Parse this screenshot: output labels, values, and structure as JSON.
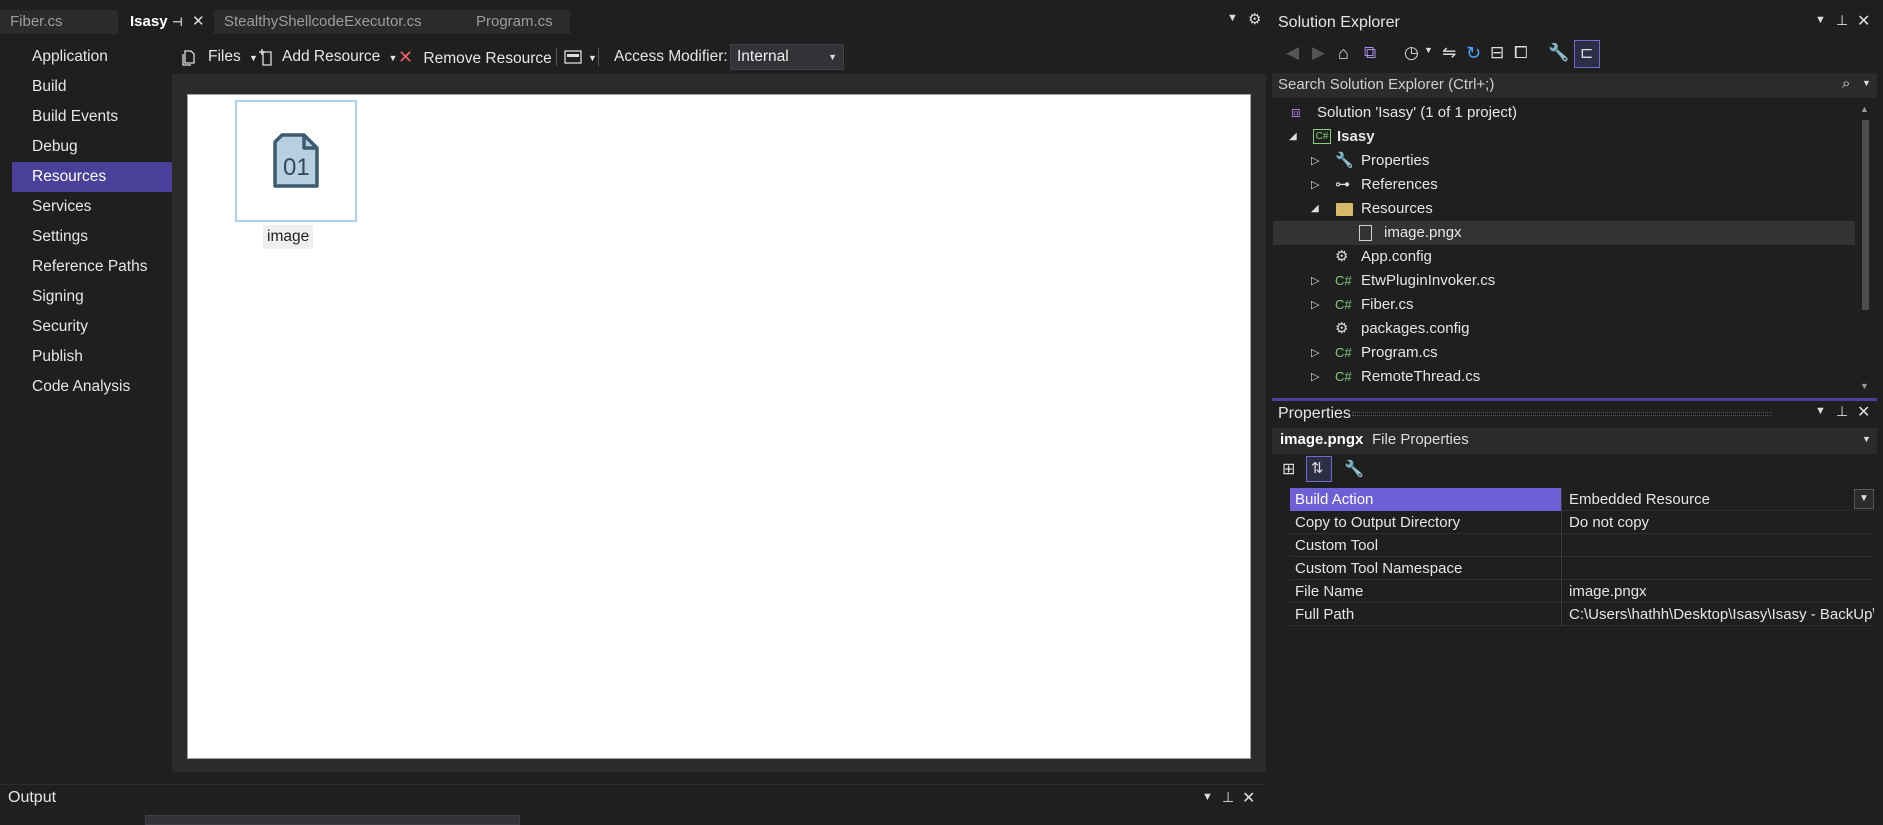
{
  "tabs": [
    {
      "label": "Fiber.cs"
    },
    {
      "label": "Isasy"
    },
    {
      "label": "StealthyShellcodeExecutor.cs"
    },
    {
      "label": "Program.cs"
    }
  ],
  "nav": {
    "items": [
      "Application",
      "Build",
      "Build Events",
      "Debug",
      "Resources",
      "Services",
      "Settings",
      "Reference Paths",
      "Signing",
      "Security",
      "Publish",
      "Code Analysis"
    ],
    "selected": "Resources"
  },
  "toolbar": {
    "files_label": "Files",
    "add_resource_label": "Add Resource",
    "remove_resource_label": "Remove Resource",
    "access_modifier_label": "Access Modifier:",
    "access_modifier_value": "Internal"
  },
  "resource": {
    "label": "image",
    "icon_text": "01"
  },
  "solution_explorer": {
    "title": "Solution Explorer",
    "search_placeholder": "Search Solution Explorer (Ctrl+;)",
    "solution_label": "Solution 'Isasy' (1 of 1 project)",
    "tree": [
      {
        "label": "Isasy",
        "icon": "csharp-project-icon"
      },
      {
        "label": "Properties",
        "icon": "wrench-icon"
      },
      {
        "label": "References",
        "icon": "references-icon"
      },
      {
        "label": "Resources",
        "icon": "folder-icon"
      },
      {
        "label": "image.pngx",
        "icon": "file-icon"
      },
      {
        "label": "App.config",
        "icon": "config-icon"
      },
      {
        "label": "EtwPluginInvoker.cs",
        "icon": "csharp-file-icon"
      },
      {
        "label": "Fiber.cs",
        "icon": "csharp-file-icon"
      },
      {
        "label": "packages.config",
        "icon": "config-icon"
      },
      {
        "label": "Program.cs",
        "icon": "csharp-file-icon"
      },
      {
        "label": "RemoteThread.cs",
        "icon": "csharp-file-icon"
      }
    ]
  },
  "properties": {
    "title": "Properties",
    "object_name": "image.pngx",
    "object_type": "File Properties",
    "rows": [
      {
        "name": "Build Action",
        "value": "Embedded Resource"
      },
      {
        "name": "Copy to Output Directory",
        "value": "Do not copy"
      },
      {
        "name": "Custom Tool",
        "value": ""
      },
      {
        "name": "Custom Tool Namespace",
        "value": ""
      },
      {
        "name": "File Name",
        "value": "image.pngx"
      },
      {
        "name": "Full Path",
        "value": "C:\\Users\\hathh\\Desktop\\Isasy\\Isasy - BackUp\\Is"
      }
    ]
  },
  "output": {
    "title": "Output"
  },
  "colors": {
    "accent": "#4a3f99",
    "panel_bg": "#1f1f1f",
    "csharp_green": "#7fd07f"
  }
}
